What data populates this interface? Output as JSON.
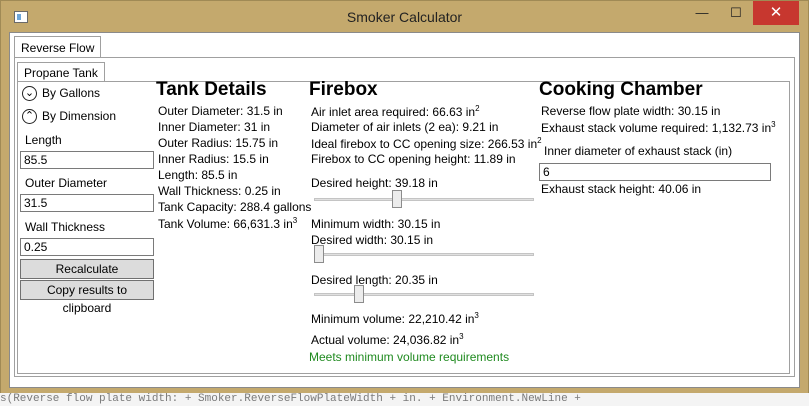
{
  "window": {
    "title": "Smoker Calculator",
    "min_glyph": "—",
    "max_glyph": "☐",
    "close_glyph": "✕"
  },
  "tabs": {
    "outer": "Reverse Flow",
    "inner": "Propane Tank"
  },
  "inputs_panel": {
    "radio_gallons": "By Gallons",
    "radio_dimension": "By Dimension",
    "length_label": "Length",
    "length_value": "85.5",
    "outer_diameter_label": "Outer Diameter",
    "outer_diameter_value": "31.5",
    "wall_thickness_label": "Wall Thickness",
    "wall_thickness_value": "0.25",
    "recalculate": "Recalculate",
    "copy": "Copy results to clipboard"
  },
  "tank_details": {
    "heading": "Tank Details",
    "lines": [
      "Outer Diameter: 31.5 in",
      "Inner Diameter: 31 in",
      "Outer Radius: 15.75 in",
      "Inner Radius: 15.5 in",
      "Length: 85.5 in",
      "Wall Thickness: 0.25 in",
      "Tank Capacity: 288.4 gallons"
    ],
    "volume": "Tank Volume: 66,631.3 in",
    "volume_unit_exp": "3"
  },
  "firebox": {
    "heading": "Firebox",
    "air_inlet": "Air inlet area required: 66.63 in",
    "air_inlet_exp": "2",
    "diameter": "Diameter of air inlets (2 ea): 9.21 in",
    "ideal_opening": "Ideal firebox to CC opening size: 266.53 in",
    "ideal_opening_exp": "2",
    "opening_height": "Firebox to CC opening height: 11.89 in",
    "desired_height": "Desired height: 39.18 in",
    "desired_height_fraction": 0.37,
    "min_width": "Minimum width: 30.15 in",
    "desired_width": "Desired width: 30.15 in",
    "desired_width_fraction": 0.0,
    "desired_length": "Desired length: 20.35 in",
    "desired_length_fraction": 0.19,
    "min_volume": "Minimum volume: 22,210.42 in",
    "min_volume_exp": "3",
    "actual_volume": "Actual volume: 24,036.82 in",
    "actual_volume_exp": "3",
    "status": "Meets minimum volume requirements",
    "status_color": "#1f8a1f"
  },
  "cooking_chamber": {
    "heading": "Cooking Chamber",
    "plate_width": "Reverse flow plate width: 30.15 in",
    "stack_volume": "Exhaust stack volume required: 1,132.73 in",
    "stack_volume_exp": "3",
    "inner_diameter_label": "Inner diameter of exhaust stack (in)",
    "inner_diameter_value": "6",
    "stack_height": "Exhaust stack height: 40.06 in"
  },
  "background_code": "s(Reverse flow plate width:   + Smoker.ReverseFlowPlateWidth +   in.  + Environment.NewLine +"
}
